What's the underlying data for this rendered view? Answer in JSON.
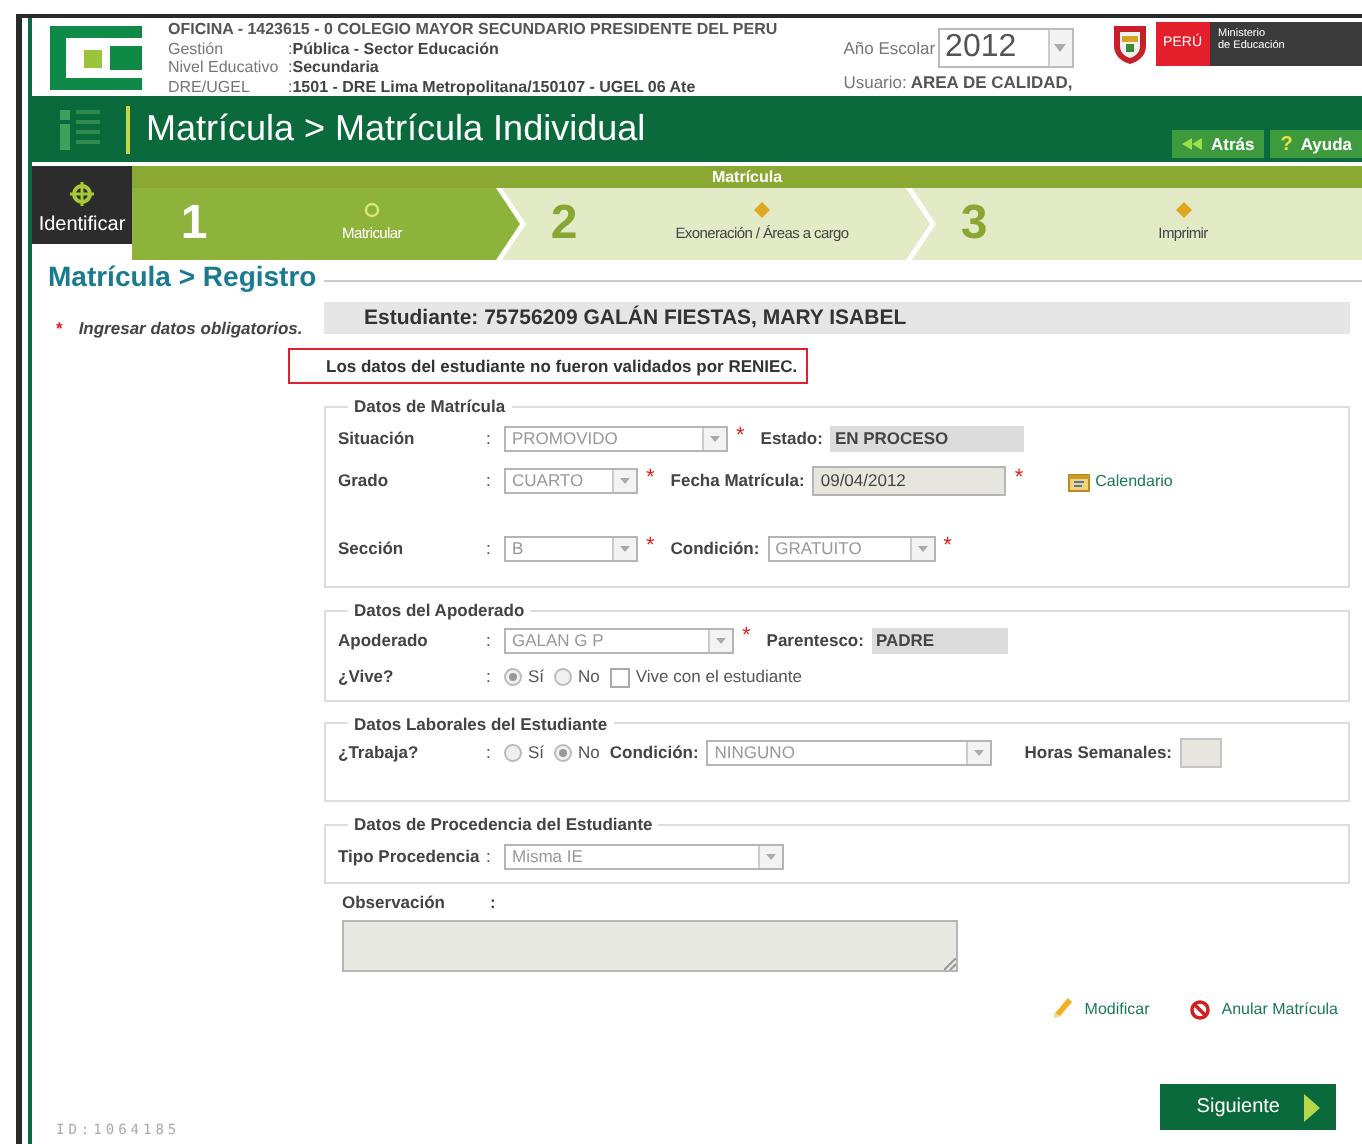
{
  "header": {
    "office": "OFICINA - 1423615 - 0  COLEGIO MAYOR SECUNDARIO PRESIDENTE DEL PERU",
    "details": [
      {
        "label": "Gestión",
        "colon": ":",
        "value": "Pública - Sector Educación"
      },
      {
        "label": "Nivel Educativo",
        "colon": ":",
        "value": "Secundaria"
      },
      {
        "label": "DRE/UGEL",
        "colon": ":",
        "value": "1501 - DRE Lima Metropolitana/150107 - UGEL 06 Ate"
      }
    ],
    "year_label": "Año Escolar",
    "year": "2012",
    "user_label": "Usuario:",
    "user": "AREA DE CALIDAD,",
    "country": "PERÚ",
    "ministry": [
      "Ministerio",
      "de Educación"
    ]
  },
  "nav": {
    "title": "Matrícula > Matrícula Individual",
    "buttons": [
      {
        "kind": "back",
        "label": "Atrás"
      },
      {
        "kind": "help",
        "symbol": "?",
        "label": "Ayuda"
      }
    ]
  },
  "wizard": {
    "identify": "Identificar",
    "group": "Matrícula",
    "steps": [
      {
        "number": "1",
        "label": "Matricular",
        "selected": true
      },
      {
        "number": "2",
        "label": "Exoneración / Áreas a cargo",
        "selected": false
      },
      {
        "number": "3",
        "label": "Imprimir",
        "selected": false
      }
    ]
  },
  "section_title": "Matrícula > Registro",
  "required_note": {
    "mark": "*",
    "text": "Ingresar datos obligatorios."
  },
  "student": "Estudiante: 75756209 GALÁN FIESTAS, MARY ISABEL",
  "alert": "Los datos del estudiante no fueron validados por RENIEC.",
  "fieldsets": [
    {
      "legend": "Datos de Matrícula",
      "rows": [
        {
          "label": "Situación",
          "colon": ":",
          "fields": [
            {
              "kind": "select",
              "value": "PROMOVIDO",
              "required": true
            },
            {
              "kind": "readonly",
              "label": "Estado:",
              "value": "EN PROCESO"
            }
          ]
        },
        {
          "label": "Grado",
          "colon": ":",
          "fields": [
            {
              "kind": "select",
              "value": "CUARTO",
              "required": true
            },
            {
              "kind": "date",
              "label": "Fecha Matrícula:",
              "value": "09/04/2012",
              "required": true
            },
            {
              "kind": "link",
              "label": "Calendario"
            }
          ]
        },
        {
          "label": "Sección",
          "colon": ":",
          "fields": [
            {
              "kind": "select",
              "value": "B",
              "required": true
            },
            {
              "kind": "select",
              "label": "Condición:",
              "value": "GRATUITO",
              "required": true
            }
          ]
        }
      ]
    },
    {
      "legend": "Datos del Apoderado",
      "rows": [
        {
          "label": "Apoderado",
          "colon": ":",
          "fields": [
            {
              "kind": "select",
              "value": "GALAN G P",
              "required": true
            },
            {
              "kind": "readonly",
              "label": "Parentesco:",
              "value": "PADRE"
            }
          ]
        },
        {
          "label": "¿Vive?",
          "colon": ":",
          "fields": [
            {
              "kind": "radio",
              "label": "Sí",
              "checked": true
            },
            {
              "kind": "radio",
              "label": "No",
              "checked": false
            },
            {
              "kind": "checkbox",
              "label": "Vive con el estudiante",
              "checked": false
            }
          ]
        }
      ]
    },
    {
      "legend": "Datos Laborales del Estudiante",
      "rows": [
        {
          "label": "¿Trabaja?",
          "colon": ":",
          "fields": [
            {
              "kind": "radio",
              "label": "Sí",
              "checked": false
            },
            {
              "kind": "radio",
              "label": "No",
              "checked": true
            },
            {
              "kind": "select",
              "label": "Condición:",
              "value": "NINGUNO",
              "required": false
            },
            {
              "kind": "input",
              "label": "Horas Semanales:"
            }
          ]
        }
      ]
    },
    {
      "legend": "Datos de Procedencia del Estudiante",
      "rows": [
        {
          "label": "Tipo Procedencia",
          "colon": ":",
          "fields": [
            {
              "kind": "select",
              "value": "Misma IE",
              "required": false
            }
          ]
        }
      ]
    }
  ],
  "observation": {
    "label": "Observación",
    "colon": ":"
  },
  "actions": [
    {
      "kind": "edit",
      "label": "Modificar"
    },
    {
      "kind": "cancel",
      "label": "Anular Matrícula"
    }
  ],
  "next_button": "Siguiente",
  "record_id": "ID:1064185"
}
